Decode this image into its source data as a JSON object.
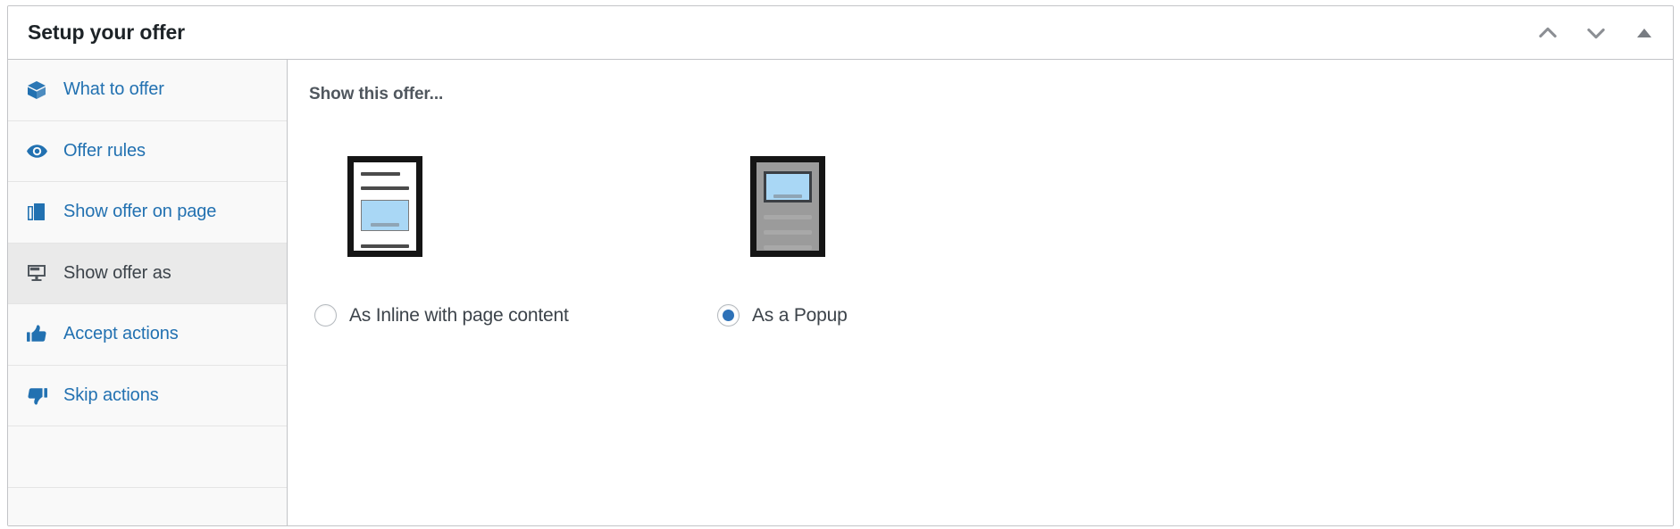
{
  "header": {
    "title": "Setup your offer",
    "actions": [
      {
        "name": "move-up-button",
        "icon": "chevron-up-icon"
      },
      {
        "name": "move-down-button",
        "icon": "chevron-down-icon"
      },
      {
        "name": "collapse-panel-button",
        "icon": "triangle-up-icon"
      }
    ]
  },
  "sidebar": {
    "items": [
      {
        "label": "What to offer",
        "icon": "box-icon",
        "active": false
      },
      {
        "label": "Offer rules",
        "icon": "eye-icon",
        "active": false
      },
      {
        "label": "Show offer on page",
        "icon": "pages-icon",
        "active": false
      },
      {
        "label": "Show offer as",
        "icon": "desktop-icon",
        "active": true
      },
      {
        "label": "Accept actions",
        "icon": "thumbs-up-icon",
        "active": false
      },
      {
        "label": "Skip actions",
        "icon": "thumbs-down-icon",
        "active": false
      }
    ]
  },
  "main": {
    "heading": "Show this offer...",
    "options": [
      {
        "label": "As Inline with page content",
        "value": "inline",
        "selected": false,
        "thumbnail": "inline-page-thumbnail"
      },
      {
        "label": "As a Popup",
        "value": "popup",
        "selected": true,
        "thumbnail": "popup-page-thumbnail"
      }
    ]
  },
  "colors": {
    "link_blue": "#2271b1",
    "radio_blue": "#2e72b8",
    "thumb_blue": "#a9d7f5",
    "active_row": "#eaeaea",
    "panel_border": "#c3c4c7",
    "title_text": "#1d2327"
  }
}
